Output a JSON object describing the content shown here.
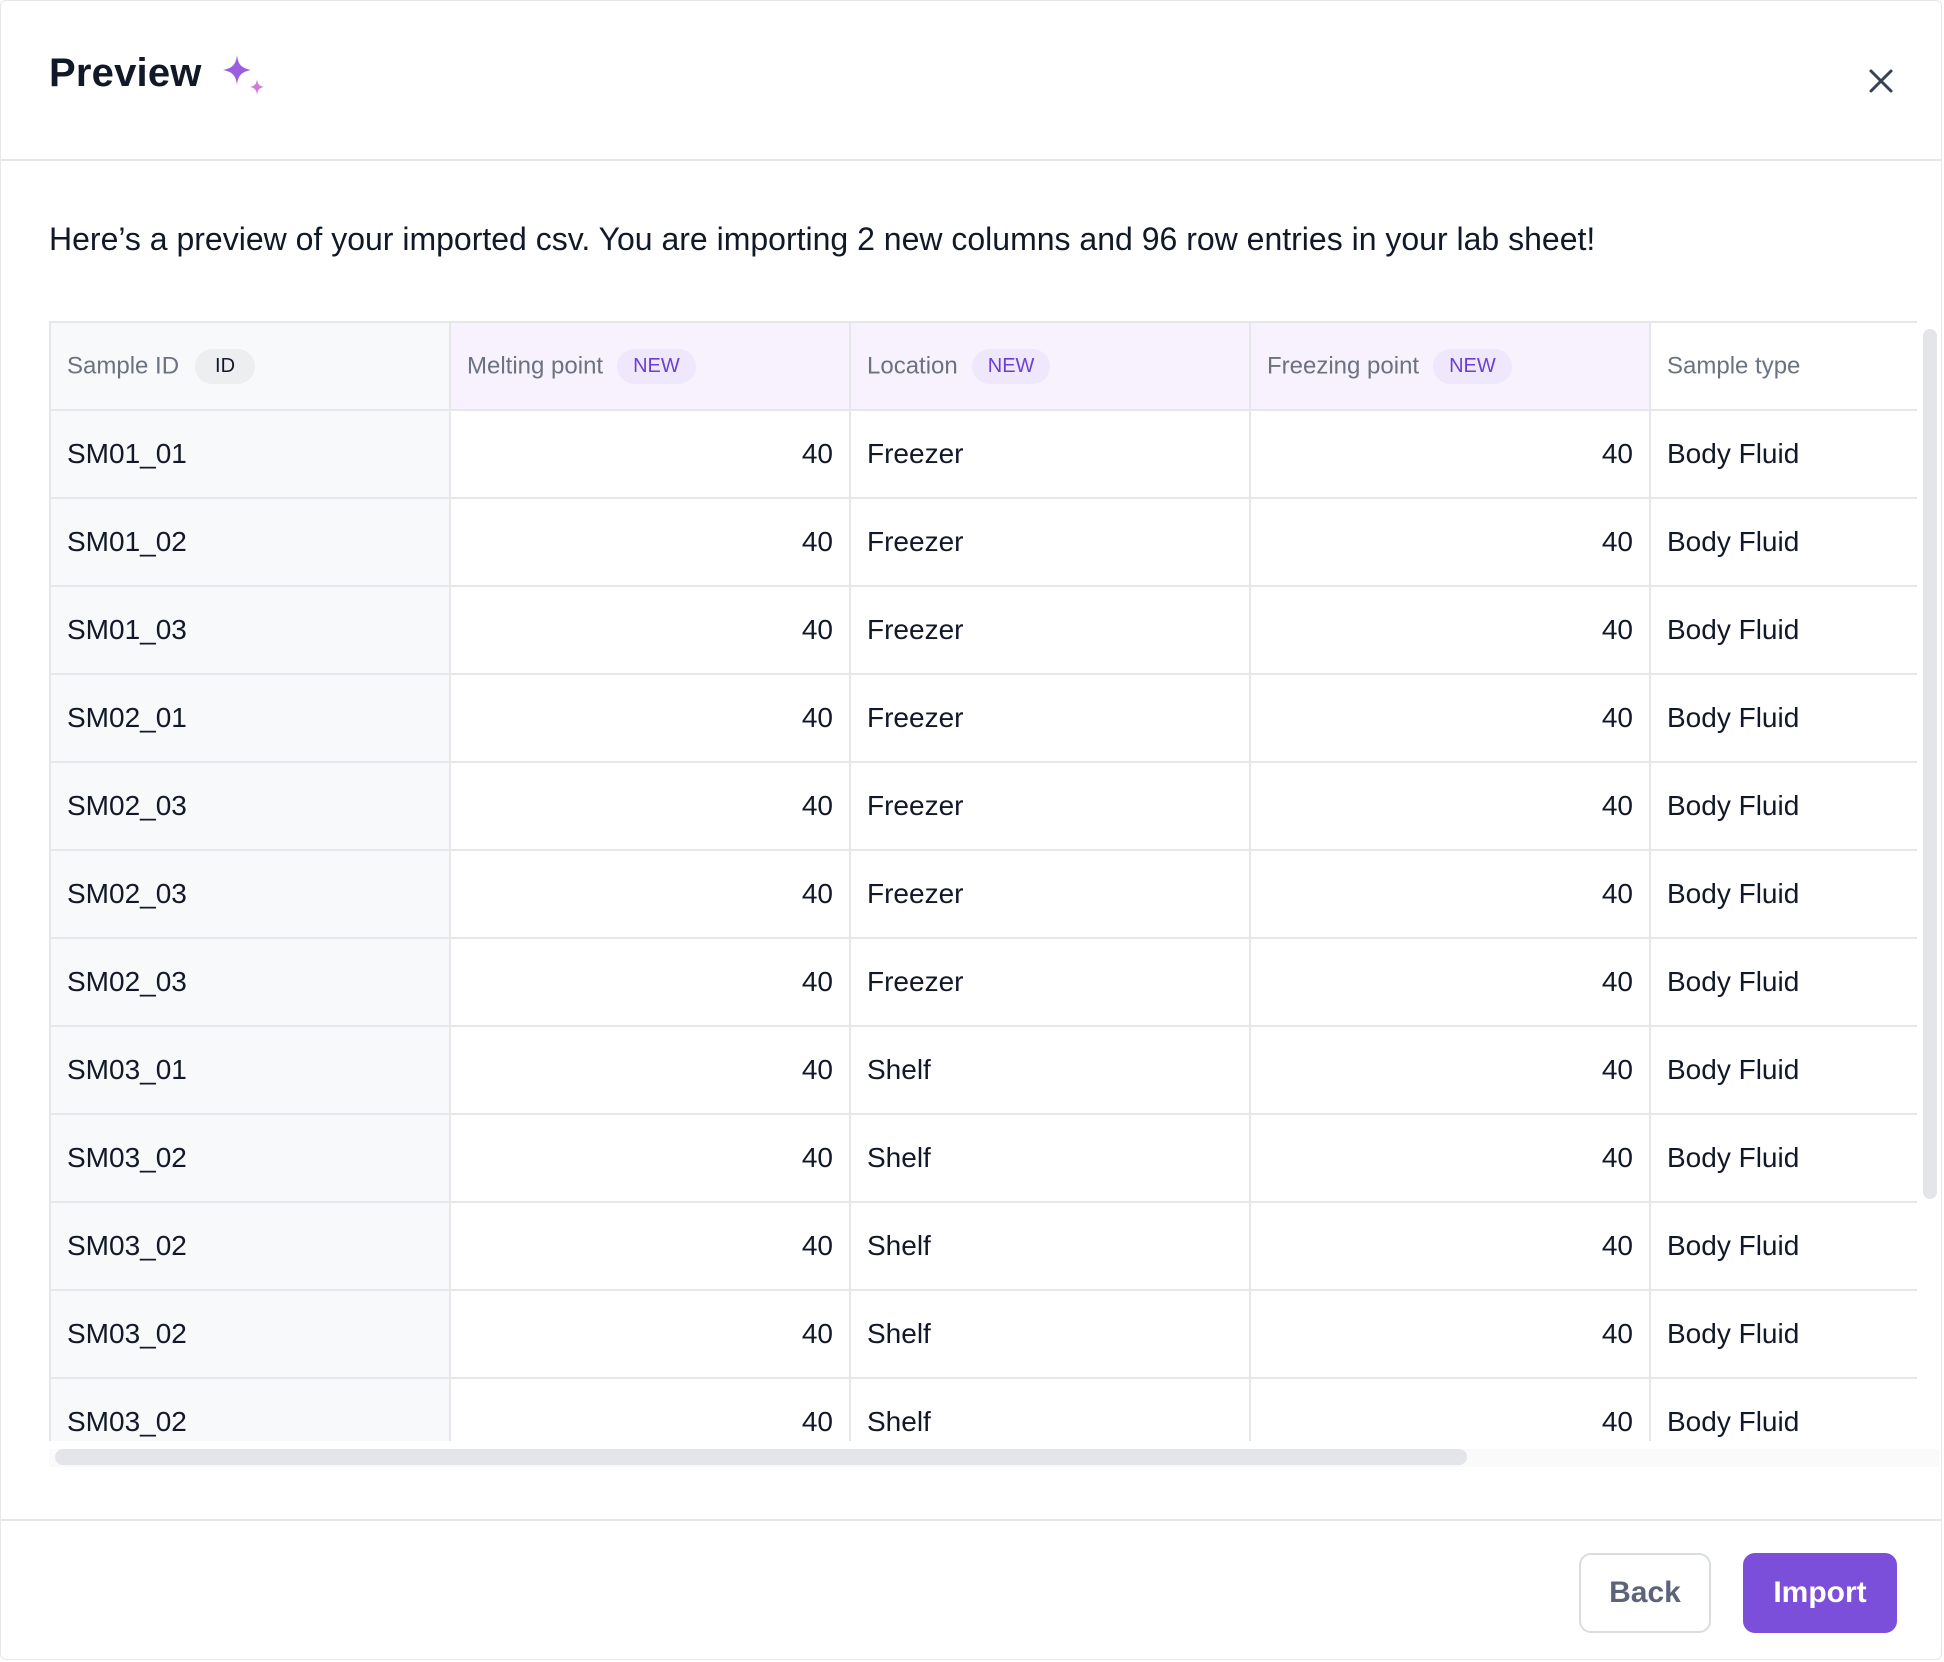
{
  "dialog": {
    "title": "Preview",
    "description": "Here’s a preview of your imported csv. You are importing 2 new columns and 96 row entries in your lab sheet!",
    "icons": {
      "title": "sparkle-icon",
      "close": "close-icon"
    },
    "colors": {
      "accent": "#7b4fd9",
      "new_badge_text": "#6d3fd1",
      "new_badge_bg": "#efe8fd",
      "new_column_header_bg": "#f7f2fe"
    }
  },
  "table": {
    "columns": [
      {
        "label": "Sample ID",
        "badge": "ID"
      },
      {
        "label": "Melting point",
        "badge": "NEW"
      },
      {
        "label": "Location",
        "badge": "NEW"
      },
      {
        "label": "Freezing point",
        "badge": "NEW"
      },
      {
        "label": "Sample type",
        "badge": ""
      }
    ],
    "rows": [
      [
        "SM01_01",
        "40",
        "Freezer",
        "40",
        "Body Fluid"
      ],
      [
        "SM01_02",
        "40",
        "Freezer",
        "40",
        "Body Fluid"
      ],
      [
        "SM01_03",
        "40",
        "Freezer",
        "40",
        "Body Fluid"
      ],
      [
        "SM02_01",
        "40",
        "Freezer",
        "40",
        "Body Fluid"
      ],
      [
        "SM02_03",
        "40",
        "Freezer",
        "40",
        "Body Fluid"
      ],
      [
        "SM02_03",
        "40",
        "Freezer",
        "40",
        "Body Fluid"
      ],
      [
        "SM02_03",
        "40",
        "Freezer",
        "40",
        "Body Fluid"
      ],
      [
        "SM03_01",
        "40",
        "Shelf",
        "40",
        "Body Fluid"
      ],
      [
        "SM03_02",
        "40",
        "Shelf",
        "40",
        "Body Fluid"
      ],
      [
        "SM03_02",
        "40",
        "Shelf",
        "40",
        "Body Fluid"
      ],
      [
        "SM03_02",
        "40",
        "Shelf",
        "40",
        "Body Fluid"
      ],
      [
        "SM03_02",
        "40",
        "Shelf",
        "40",
        "Body Fluid"
      ]
    ]
  },
  "footer": {
    "back_label": "Back",
    "import_label": "Import"
  }
}
